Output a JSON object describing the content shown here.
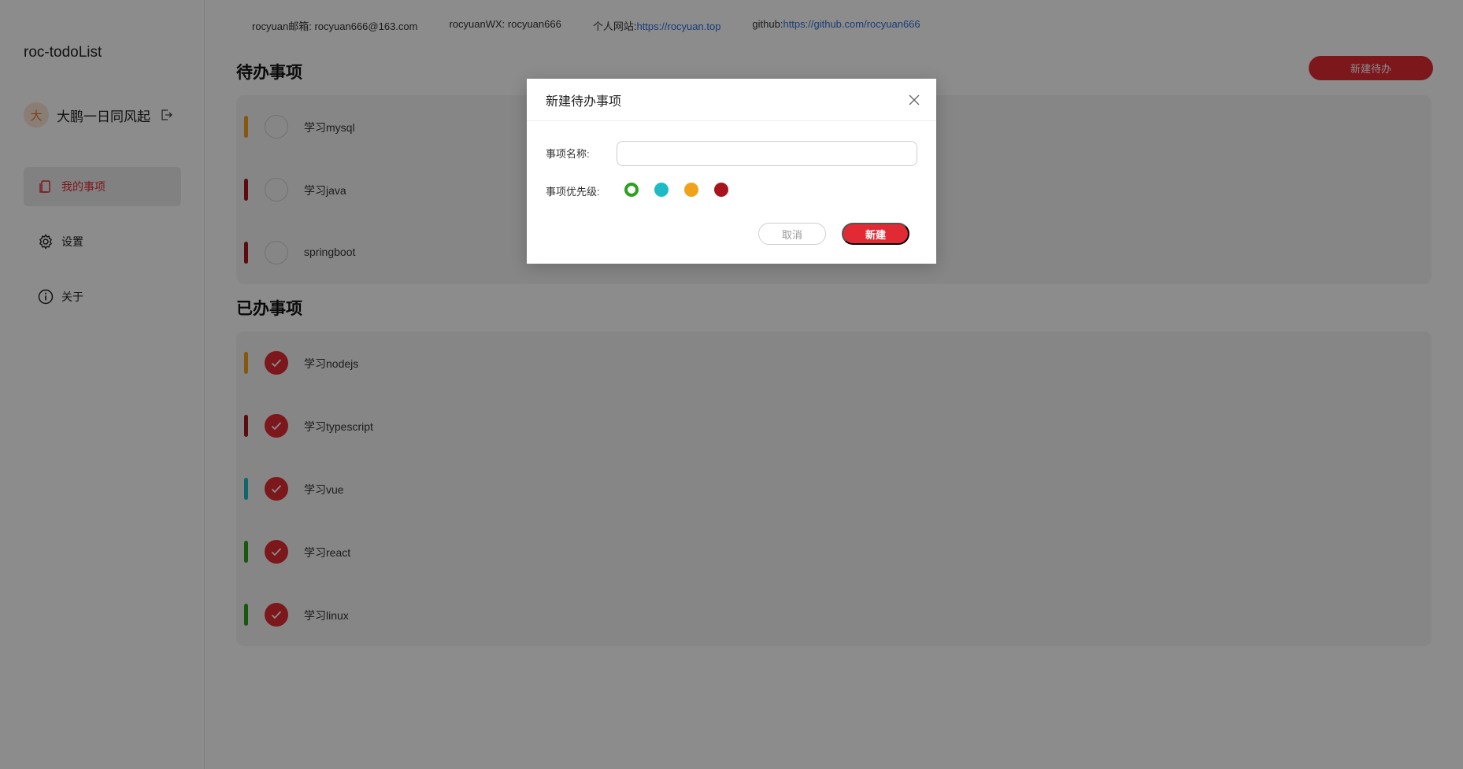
{
  "app": {
    "title": "roc-todoList"
  },
  "user": {
    "avatar_text": "大",
    "name": "大鹏一日同风起"
  },
  "nav": [
    {
      "label": "我的事项",
      "icon": "document-icon",
      "active": true
    },
    {
      "label": "设置",
      "icon": "gear-icon",
      "active": false
    },
    {
      "label": "关于",
      "icon": "info-icon",
      "active": false
    }
  ],
  "topbar": {
    "email_label": "rocyuan邮箱: rocyuan666@163.com",
    "wx_label": "rocyuanWX: rocyuan666",
    "site_prefix": "个人网站:",
    "site_link": "https://rocyuan.top",
    "github_prefix": "github:",
    "github_link": "https://github.com/rocyuan666"
  },
  "pending": {
    "title": "待办事项",
    "new_button": "新建待办",
    "items": [
      {
        "text": "学习mysql",
        "color": "#f0a21a",
        "done": false
      },
      {
        "text": "学习java",
        "color": "#a8141d",
        "done": false
      },
      {
        "text": "springboot",
        "color": "#a8141d",
        "done": false
      }
    ]
  },
  "completed": {
    "title": "已办事项",
    "items": [
      {
        "text": "学习nodejs",
        "color": "#f0a21a",
        "done": true
      },
      {
        "text": "学习typescript",
        "color": "#a8141d",
        "done": true
      },
      {
        "text": "学习vue",
        "color": "#1dbcc4",
        "done": true
      },
      {
        "text": "学习react",
        "color": "#2e9f1f",
        "done": true
      },
      {
        "text": "学习linux",
        "color": "#2e9f1f",
        "done": true
      }
    ]
  },
  "modal": {
    "title": "新建待办事项",
    "name_label": "事项名称:",
    "name_value": "",
    "priority_label": "事项优先级:",
    "priorities": [
      {
        "color": "#2e9f1f",
        "selected": true
      },
      {
        "color": "#1dbcc4",
        "selected": false
      },
      {
        "color": "#f0a21a",
        "selected": false
      },
      {
        "color": "#a8141d",
        "selected": false
      }
    ],
    "cancel_label": "取消",
    "create_label": "新建"
  },
  "colors": {
    "accent": "#e22a34"
  }
}
